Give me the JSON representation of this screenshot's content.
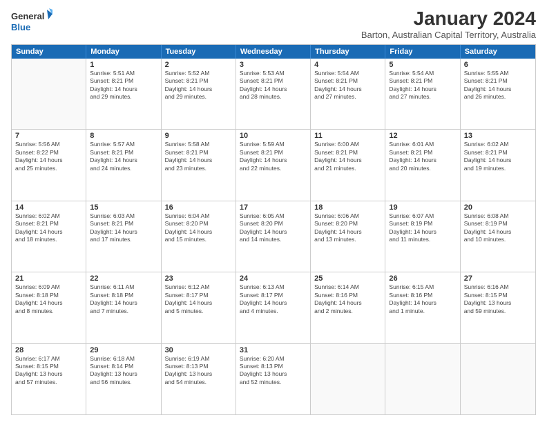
{
  "logo": {
    "line1": "General",
    "line2": "Blue"
  },
  "title": "January 2024",
  "subtitle": "Barton, Australian Capital Territory, Australia",
  "days_of_week": [
    "Sunday",
    "Monday",
    "Tuesday",
    "Wednesday",
    "Thursday",
    "Friday",
    "Saturday"
  ],
  "weeks": [
    [
      {
        "num": "",
        "info": ""
      },
      {
        "num": "1",
        "info": "Sunrise: 5:51 AM\nSunset: 8:21 PM\nDaylight: 14 hours\nand 29 minutes."
      },
      {
        "num": "2",
        "info": "Sunrise: 5:52 AM\nSunset: 8:21 PM\nDaylight: 14 hours\nand 29 minutes."
      },
      {
        "num": "3",
        "info": "Sunrise: 5:53 AM\nSunset: 8:21 PM\nDaylight: 14 hours\nand 28 minutes."
      },
      {
        "num": "4",
        "info": "Sunrise: 5:54 AM\nSunset: 8:21 PM\nDaylight: 14 hours\nand 27 minutes."
      },
      {
        "num": "5",
        "info": "Sunrise: 5:54 AM\nSunset: 8:21 PM\nDaylight: 14 hours\nand 27 minutes."
      },
      {
        "num": "6",
        "info": "Sunrise: 5:55 AM\nSunset: 8:21 PM\nDaylight: 14 hours\nand 26 minutes."
      }
    ],
    [
      {
        "num": "7",
        "info": "Sunrise: 5:56 AM\nSunset: 8:22 PM\nDaylight: 14 hours\nand 25 minutes."
      },
      {
        "num": "8",
        "info": "Sunrise: 5:57 AM\nSunset: 8:21 PM\nDaylight: 14 hours\nand 24 minutes."
      },
      {
        "num": "9",
        "info": "Sunrise: 5:58 AM\nSunset: 8:21 PM\nDaylight: 14 hours\nand 23 minutes."
      },
      {
        "num": "10",
        "info": "Sunrise: 5:59 AM\nSunset: 8:21 PM\nDaylight: 14 hours\nand 22 minutes."
      },
      {
        "num": "11",
        "info": "Sunrise: 6:00 AM\nSunset: 8:21 PM\nDaylight: 14 hours\nand 21 minutes."
      },
      {
        "num": "12",
        "info": "Sunrise: 6:01 AM\nSunset: 8:21 PM\nDaylight: 14 hours\nand 20 minutes."
      },
      {
        "num": "13",
        "info": "Sunrise: 6:02 AM\nSunset: 8:21 PM\nDaylight: 14 hours\nand 19 minutes."
      }
    ],
    [
      {
        "num": "14",
        "info": "Sunrise: 6:02 AM\nSunset: 8:21 PM\nDaylight: 14 hours\nand 18 minutes."
      },
      {
        "num": "15",
        "info": "Sunrise: 6:03 AM\nSunset: 8:21 PM\nDaylight: 14 hours\nand 17 minutes."
      },
      {
        "num": "16",
        "info": "Sunrise: 6:04 AM\nSunset: 8:20 PM\nDaylight: 14 hours\nand 15 minutes."
      },
      {
        "num": "17",
        "info": "Sunrise: 6:05 AM\nSunset: 8:20 PM\nDaylight: 14 hours\nand 14 minutes."
      },
      {
        "num": "18",
        "info": "Sunrise: 6:06 AM\nSunset: 8:20 PM\nDaylight: 14 hours\nand 13 minutes."
      },
      {
        "num": "19",
        "info": "Sunrise: 6:07 AM\nSunset: 8:19 PM\nDaylight: 14 hours\nand 11 minutes."
      },
      {
        "num": "20",
        "info": "Sunrise: 6:08 AM\nSunset: 8:19 PM\nDaylight: 14 hours\nand 10 minutes."
      }
    ],
    [
      {
        "num": "21",
        "info": "Sunrise: 6:09 AM\nSunset: 8:18 PM\nDaylight: 14 hours\nand 8 minutes."
      },
      {
        "num": "22",
        "info": "Sunrise: 6:11 AM\nSunset: 8:18 PM\nDaylight: 14 hours\nand 7 minutes."
      },
      {
        "num": "23",
        "info": "Sunrise: 6:12 AM\nSunset: 8:17 PM\nDaylight: 14 hours\nand 5 minutes."
      },
      {
        "num": "24",
        "info": "Sunrise: 6:13 AM\nSunset: 8:17 PM\nDaylight: 14 hours\nand 4 minutes."
      },
      {
        "num": "25",
        "info": "Sunrise: 6:14 AM\nSunset: 8:16 PM\nDaylight: 14 hours\nand 2 minutes."
      },
      {
        "num": "26",
        "info": "Sunrise: 6:15 AM\nSunset: 8:16 PM\nDaylight: 14 hours\nand 1 minute."
      },
      {
        "num": "27",
        "info": "Sunrise: 6:16 AM\nSunset: 8:15 PM\nDaylight: 13 hours\nand 59 minutes."
      }
    ],
    [
      {
        "num": "28",
        "info": "Sunrise: 6:17 AM\nSunset: 8:15 PM\nDaylight: 13 hours\nand 57 minutes."
      },
      {
        "num": "29",
        "info": "Sunrise: 6:18 AM\nSunset: 8:14 PM\nDaylight: 13 hours\nand 56 minutes."
      },
      {
        "num": "30",
        "info": "Sunrise: 6:19 AM\nSunset: 8:13 PM\nDaylight: 13 hours\nand 54 minutes."
      },
      {
        "num": "31",
        "info": "Sunrise: 6:20 AM\nSunset: 8:13 PM\nDaylight: 13 hours\nand 52 minutes."
      },
      {
        "num": "",
        "info": ""
      },
      {
        "num": "",
        "info": ""
      },
      {
        "num": "",
        "info": ""
      }
    ]
  ]
}
